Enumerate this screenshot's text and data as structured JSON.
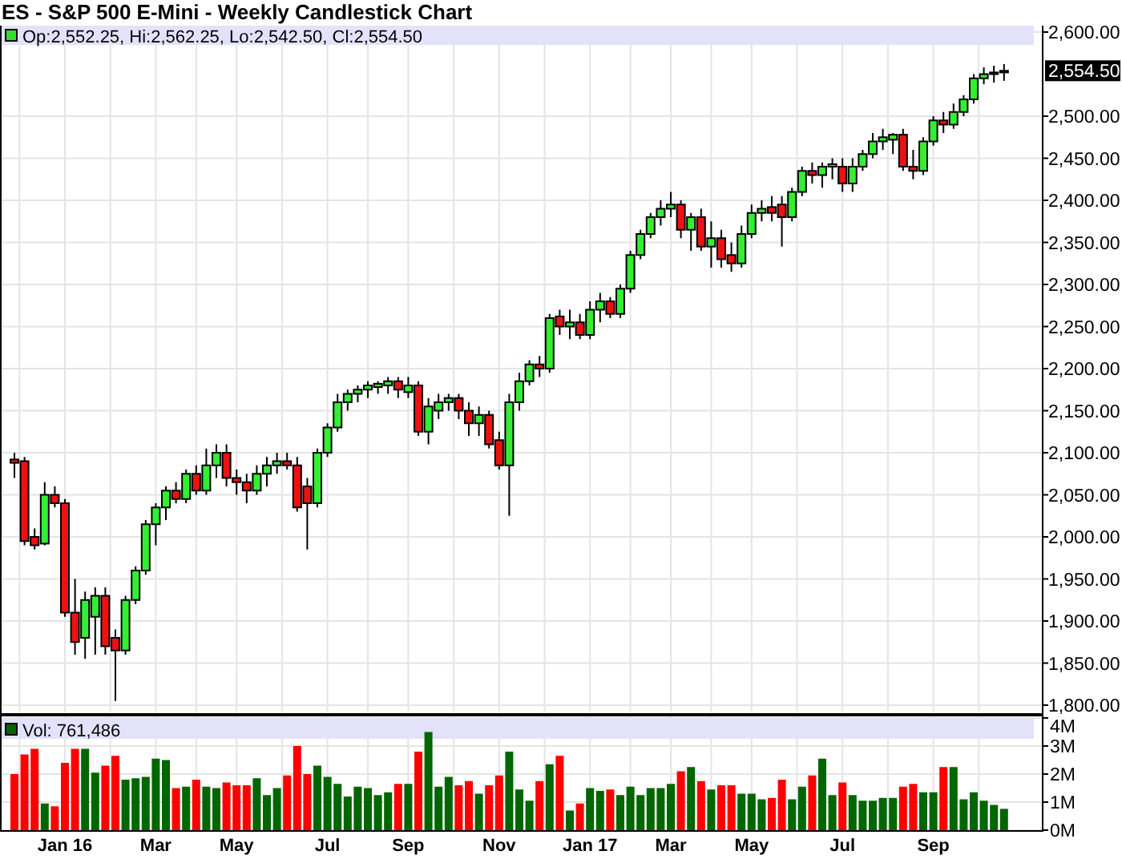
{
  "title": "ES - S&P 500 E-Mini - Weekly Candlestick Chart",
  "price_panel": {
    "legend": "Op:2,552.25, Hi:2,562.25, Lo:2,542.50, Cl:2,554.50",
    "last_price": "2,554.50",
    "chart_data": {
      "type": "candlestick",
      "grid": true,
      "ylim": [
        1800,
        2600
      ],
      "categories": [
        null,
        null,
        null,
        null,
        null,
        null,
        null,
        null,
        null,
        null,
        null,
        null,
        null,
        null,
        null,
        null,
        null,
        null,
        null,
        null,
        null,
        null,
        null,
        null,
        null,
        null,
        null,
        null,
        null,
        null,
        null,
        null,
        null,
        null,
        null,
        null,
        null,
        null,
        null,
        null,
        null,
        null,
        null,
        null,
        null,
        null,
        null,
        null,
        null,
        null,
        null,
        null,
        null,
        null,
        null,
        null,
        null,
        null,
        null,
        null,
        null,
        null,
        null,
        null,
        null,
        null,
        null,
        null,
        null,
        null,
        null,
        null,
        null,
        null,
        null,
        null,
        null,
        null,
        null,
        null,
        null,
        null,
        null,
        null,
        null,
        null,
        null,
        null,
        null,
        null,
        null,
        null,
        null,
        null,
        null,
        null,
        null,
        null,
        null
      ],
      "ohlc": [
        [
          2092,
          2100,
          2070,
          2088
        ],
        [
          2090,
          2095,
          1990,
          1995
        ],
        [
          2000,
          2010,
          1985,
          1990
        ],
        [
          1992,
          2065,
          1990,
          2050
        ],
        [
          2050,
          2060,
          2035,
          2040
        ],
        [
          2040,
          2045,
          1905,
          1910
        ],
        [
          1910,
          1950,
          1860,
          1875
        ],
        [
          1880,
          1935,
          1855,
          1925
        ],
        [
          1905,
          1940,
          1860,
          1930
        ],
        [
          1930,
          1940,
          1860,
          1870
        ],
        [
          1880,
          1890,
          1805,
          1865
        ],
        [
          1865,
          1930,
          1860,
          1925
        ],
        [
          1925,
          1965,
          1920,
          1960
        ],
        [
          1960,
          2020,
          1955,
          2015
        ],
        [
          2015,
          2040,
          1990,
          2035
        ],
        [
          2035,
          2060,
          2020,
          2055
        ],
        [
          2055,
          2065,
          2040,
          2045
        ],
        [
          2045,
          2080,
          2040,
          2075
        ],
        [
          2075,
          2085,
          2050,
          2055
        ],
        [
          2055,
          2105,
          2050,
          2085
        ],
        [
          2085,
          2110,
          2070,
          2100
        ],
        [
          2100,
          2110,
          2060,
          2070
        ],
        [
          2070,
          2080,
          2050,
          2065
        ],
        [
          2065,
          2075,
          2040,
          2055
        ],
        [
          2055,
          2085,
          2050,
          2075
        ],
        [
          2075,
          2095,
          2060,
          2085
        ],
        [
          2085,
          2100,
          2075,
          2090
        ],
        [
          2090,
          2100,
          2080,
          2085
        ],
        [
          2085,
          2095,
          2030,
          2035
        ],
        [
          2060,
          2070,
          1985,
          2040
        ],
        [
          2040,
          2105,
          2035,
          2100
        ],
        [
          2100,
          2135,
          2095,
          2130
        ],
        [
          2130,
          2170,
          2125,
          2160
        ],
        [
          2160,
          2175,
          2150,
          2170
        ],
        [
          2170,
          2180,
          2160,
          2175
        ],
        [
          2175,
          2185,
          2165,
          2180
        ],
        [
          2178,
          2185,
          2170,
          2182
        ],
        [
          2180,
          2190,
          2170,
          2185
        ],
        [
          2185,
          2190,
          2165,
          2175
        ],
        [
          2172,
          2190,
          2165,
          2180
        ],
        [
          2180,
          2185,
          2120,
          2125
        ],
        [
          2125,
          2165,
          2110,
          2155
        ],
        [
          2150,
          2170,
          2140,
          2160
        ],
        [
          2160,
          2170,
          2150,
          2165
        ],
        [
          2165,
          2170,
          2140,
          2150
        ],
        [
          2150,
          2160,
          2120,
          2135
        ],
        [
          2135,
          2155,
          2120,
          2145
        ],
        [
          2145,
          2150,
          2105,
          2110
        ],
        [
          2115,
          2125,
          2080,
          2085
        ],
        [
          2085,
          2170,
          2025,
          2160
        ],
        [
          2160,
          2195,
          2150,
          2185
        ],
        [
          2185,
          2210,
          2180,
          2205
        ],
        [
          2205,
          2215,
          2190,
          2200
        ],
        [
          2200,
          2265,
          2195,
          2260
        ],
        [
          2262,
          2270,
          2240,
          2250
        ],
        [
          2250,
          2270,
          2235,
          2255
        ],
        [
          2255,
          2265,
          2235,
          2240
        ],
        [
          2240,
          2280,
          2235,
          2270
        ],
        [
          2270,
          2290,
          2255,
          2280
        ],
        [
          2280,
          2285,
          2260,
          2265
        ],
        [
          2265,
          2300,
          2260,
          2295
        ],
        [
          2295,
          2340,
          2290,
          2335
        ],
        [
          2335,
          2365,
          2330,
          2360
        ],
        [
          2360,
          2385,
          2355,
          2380
        ],
        [
          2380,
          2400,
          2370,
          2390
        ],
        [
          2390,
          2410,
          2380,
          2395
        ],
        [
          2395,
          2400,
          2355,
          2365
        ],
        [
          2365,
          2385,
          2340,
          2380
        ],
        [
          2380,
          2390,
          2340,
          2345
        ],
        [
          2345,
          2375,
          2320,
          2355
        ],
        [
          2355,
          2365,
          2320,
          2330
        ],
        [
          2335,
          2350,
          2315,
          2325
        ],
        [
          2325,
          2370,
          2320,
          2360
        ],
        [
          2360,
          2395,
          2355,
          2385
        ],
        [
          2385,
          2400,
          2375,
          2390
        ],
        [
          2392,
          2405,
          2375,
          2385
        ],
        [
          2395,
          2405,
          2345,
          2380
        ],
        [
          2380,
          2415,
          2375,
          2410
        ],
        [
          2410,
          2440,
          2405,
          2435
        ],
        [
          2435,
          2445,
          2420,
          2430
        ],
        [
          2430,
          2445,
          2415,
          2440
        ],
        [
          2440,
          2450,
          2425,
          2443
        ],
        [
          2440,
          2450,
          2410,
          2420
        ],
        [
          2420,
          2450,
          2410,
          2440
        ],
        [
          2440,
          2460,
          2435,
          2455
        ],
        [
          2455,
          2480,
          2450,
          2470
        ],
        [
          2470,
          2485,
          2460,
          2475
        ],
        [
          2472,
          2480,
          2455,
          2478
        ],
        [
          2478,
          2485,
          2435,
          2440
        ],
        [
          2440,
          2460,
          2425,
          2435
        ],
        [
          2435,
          2475,
          2430,
          2470
        ],
        [
          2470,
          2500,
          2465,
          2495
        ],
        [
          2495,
          2505,
          2480,
          2490
        ],
        [
          2490,
          2515,
          2485,
          2505
        ],
        [
          2505,
          2525,
          2500,
          2520
        ],
        [
          2520,
          2550,
          2515,
          2545
        ],
        [
          2545,
          2558,
          2538,
          2550
        ],
        [
          2550,
          2560,
          2540,
          2552
        ],
        [
          2552,
          2562,
          2542,
          2554
        ]
      ],
      "yticks": [
        {
          "value": 2600,
          "label": "2,600.00"
        },
        {
          "value": 2500,
          "label": "2,500.00"
        },
        {
          "value": 2450,
          "label": "2,450.00"
        },
        {
          "value": 2400,
          "label": "2,400.00"
        },
        {
          "value": 2350,
          "label": "2,350.00"
        },
        {
          "value": 2300,
          "label": "2,300.00"
        },
        {
          "value": 2250,
          "label": "2,250.00"
        },
        {
          "value": 2200,
          "label": "2,200.00"
        },
        {
          "value": 2150,
          "label": "2,150.00"
        },
        {
          "value": 2100,
          "label": "2,100.00"
        },
        {
          "value": 2050,
          "label": "2,050.00"
        },
        {
          "value": 2000,
          "label": "2,000.00"
        },
        {
          "value": 1950,
          "label": "1,950.00"
        },
        {
          "value": 1900,
          "label": "1,900.00"
        },
        {
          "value": 1850,
          "label": "1,850.00"
        },
        {
          "value": 1800,
          "label": "1,800.00"
        }
      ]
    }
  },
  "volume_panel": {
    "legend": "Vol: 761,486",
    "chart_data": {
      "type": "bar",
      "grid": true,
      "ylim": [
        0,
        4
      ],
      "categories": [
        null,
        null,
        null,
        null,
        null,
        "Jan 16",
        null,
        null,
        null,
        null,
        null,
        null,
        null,
        null,
        "Mar",
        null,
        null,
        null,
        null,
        null,
        null,
        null,
        "May",
        null,
        null,
        null,
        null,
        null,
        null,
        null,
        null,
        "Jul",
        null,
        null,
        null,
        null,
        null,
        null,
        null,
        "Sep",
        null,
        null,
        null,
        null,
        null,
        null,
        null,
        null,
        "Nov",
        null,
        null,
        null,
        null,
        null,
        null,
        null,
        null,
        "Jan 17",
        null,
        null,
        null,
        null,
        null,
        null,
        null,
        "Mar",
        null,
        null,
        null,
        null,
        null,
        null,
        null,
        "May",
        null,
        null,
        null,
        null,
        null,
        null,
        null,
        null,
        "Jul",
        null,
        null,
        null,
        null,
        null,
        null,
        null,
        null,
        "Sep",
        null,
        null,
        null,
        null,
        null,
        null,
        null
      ],
      "values": [
        2.0,
        2.7,
        2.9,
        0.95,
        0.85,
        2.4,
        2.9,
        2.9,
        2.05,
        2.3,
        2.65,
        1.8,
        1.85,
        1.9,
        2.55,
        2.5,
        1.5,
        1.55,
        1.8,
        1.55,
        1.5,
        1.7,
        1.6,
        1.6,
        1.85,
        1.25,
        1.5,
        1.95,
        3.0,
        2.0,
        2.3,
        1.9,
        1.65,
        1.2,
        1.55,
        1.5,
        1.25,
        1.35,
        1.65,
        1.65,
        2.8,
        3.5,
        1.55,
        1.9,
        1.6,
        1.75,
        1.3,
        1.6,
        1.95,
        2.8,
        1.45,
        1.05,
        1.75,
        2.35,
        2.65,
        0.7,
        0.95,
        1.5,
        1.4,
        1.45,
        1.25,
        1.55,
        1.25,
        1.5,
        1.5,
        1.65,
        2.1,
        2.25,
        1.75,
        1.45,
        1.6,
        1.6,
        1.3,
        1.3,
        1.1,
        1.15,
        1.8,
        1.1,
        1.55,
        1.95,
        2.55,
        1.25,
        1.7,
        1.25,
        1.05,
        1.05,
        1.15,
        1.15,
        1.55,
        1.65,
        1.35,
        1.35,
        2.25,
        2.25,
        1.1,
        1.35,
        1.05,
        0.9,
        0.76
      ],
      "yticks": [
        {
          "value": 4,
          "label": "4M"
        },
        {
          "value": 3,
          "label": "3M"
        },
        {
          "value": 2,
          "label": "2M"
        },
        {
          "value": 1,
          "label": "1M"
        },
        {
          "value": 0,
          "label": "0M"
        }
      ]
    }
  }
}
